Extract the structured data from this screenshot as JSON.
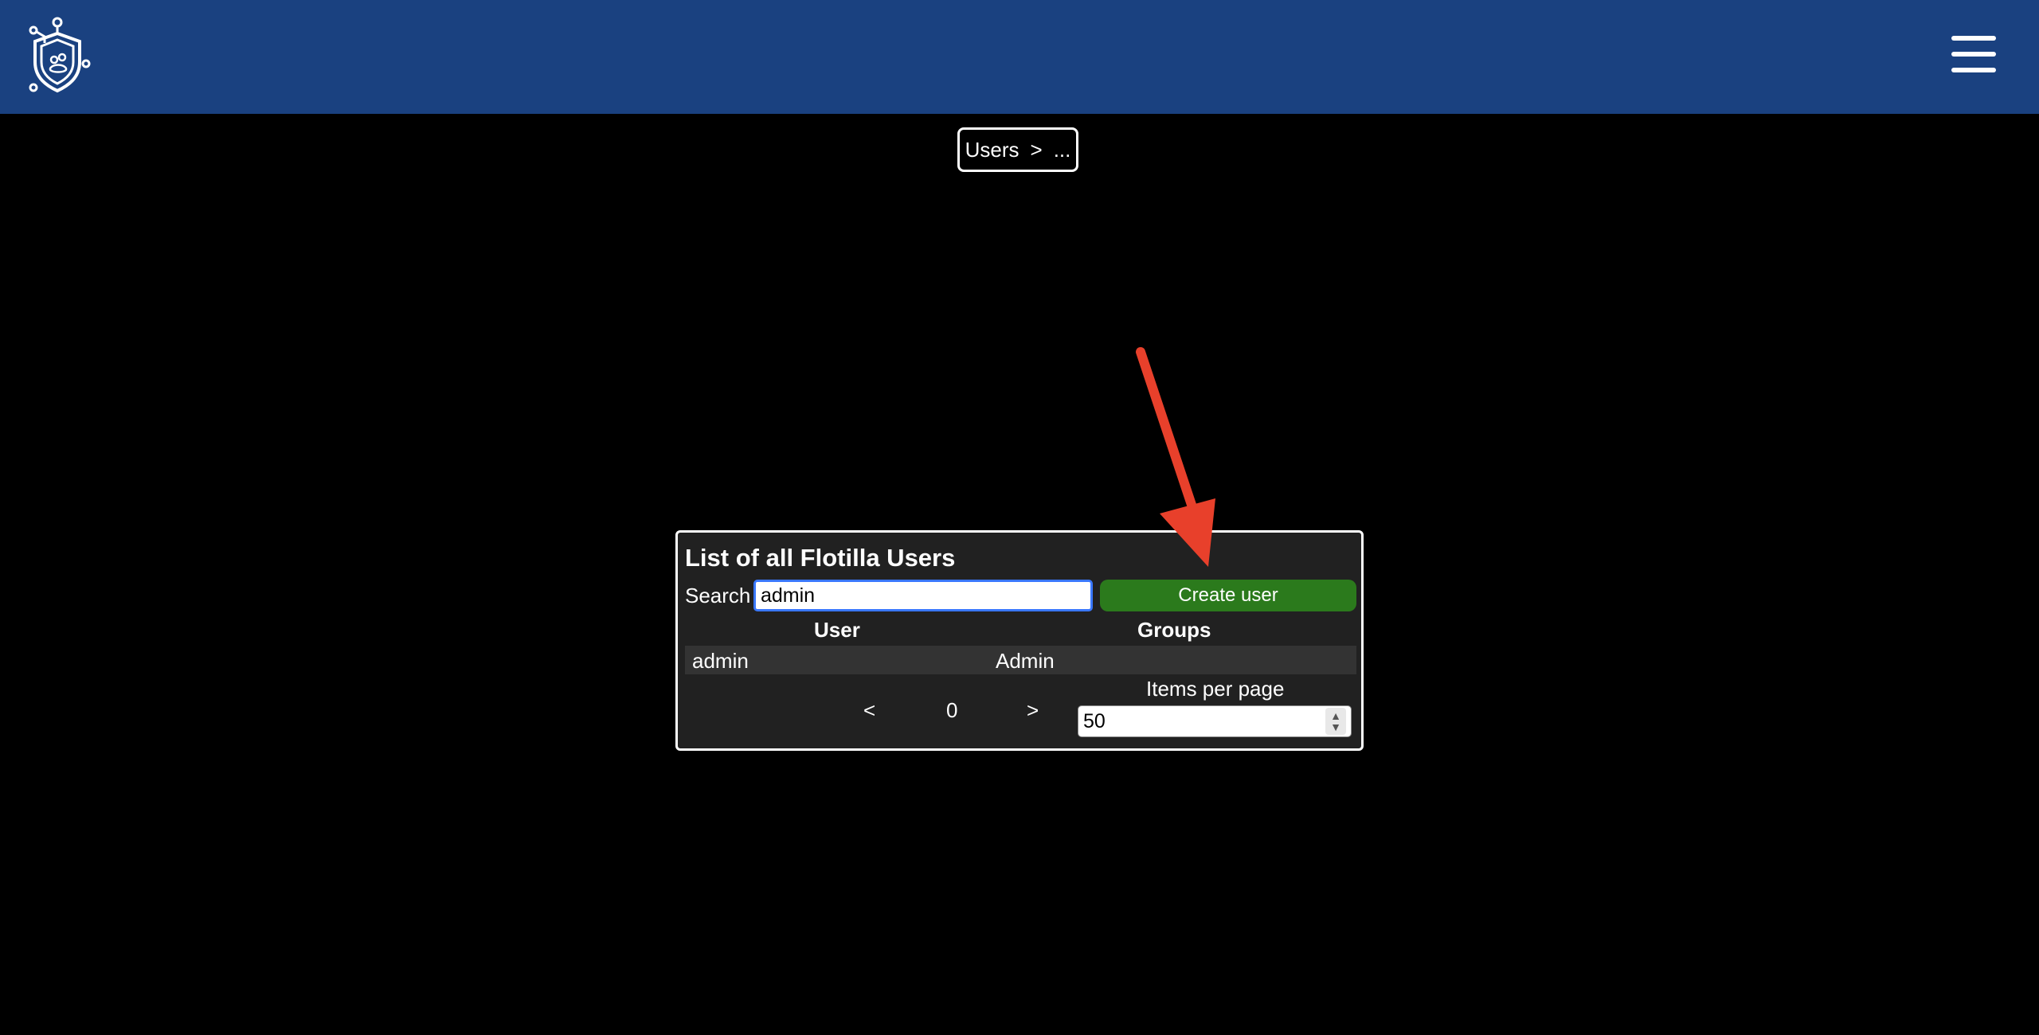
{
  "header": {
    "logo_icon": "shield-paw-logo",
    "menu_icon": "hamburger-menu-icon",
    "background": "#1a4180"
  },
  "breadcrumb": {
    "items": [
      "Users",
      ">",
      "..."
    ]
  },
  "users_panel": {
    "title": "List of all Flotilla Users",
    "search_label": "Search",
    "search_value": "admin",
    "create_button_label": "Create user",
    "columns": [
      "User",
      "Groups"
    ],
    "rows": [
      {
        "user": "admin",
        "groups": "Admin"
      }
    ],
    "pager": {
      "prev": "<",
      "page": "0",
      "next": ">"
    },
    "items_per_page_label": "Items per page",
    "items_per_page_value": "50"
  },
  "colors": {
    "panel_bg": "#212121",
    "row_bg": "#333333",
    "create_button": "#2b7a1c",
    "search_focus_border": "#3a78ff",
    "annotation_arrow": "#e8402b"
  }
}
